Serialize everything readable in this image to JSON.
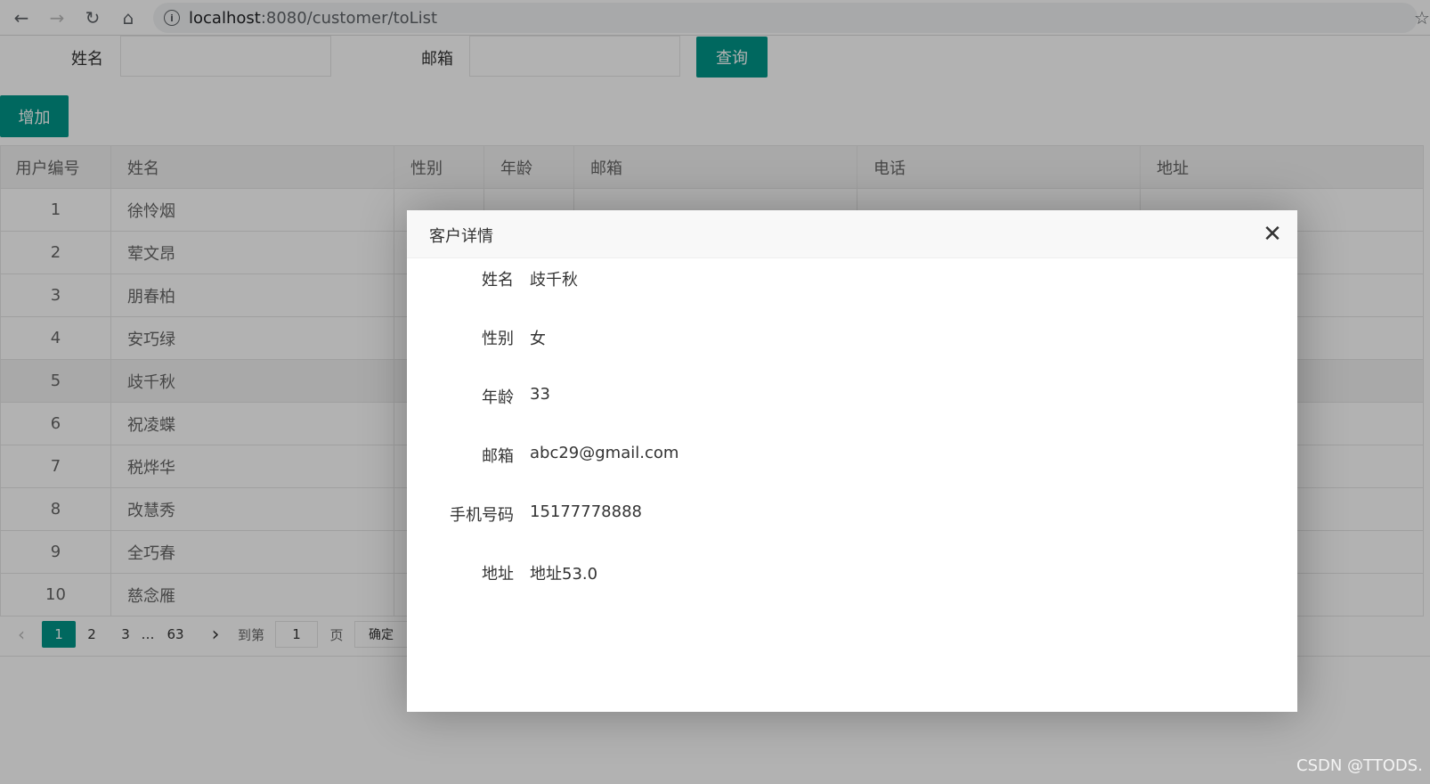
{
  "browser": {
    "url_host": "localhost",
    "url_path": ":8080/customer/toList"
  },
  "search": {
    "name_label": "姓名",
    "email_label": "邮箱",
    "query_button": "查询",
    "name_value": "",
    "email_value": ""
  },
  "add_button": "增加",
  "table": {
    "columns": [
      "用户编号",
      "姓名",
      "性别",
      "年龄",
      "邮箱",
      "电话",
      "地址"
    ],
    "rows": [
      {
        "id": "1",
        "name": "徐怜烟"
      },
      {
        "id": "2",
        "name": "荤文昂"
      },
      {
        "id": "3",
        "name": "朋春柏"
      },
      {
        "id": "4",
        "name": "安巧绿"
      },
      {
        "id": "5",
        "name": "歧千秋"
      },
      {
        "id": "6",
        "name": "祝凌蝶"
      },
      {
        "id": "7",
        "name": "税烨华"
      },
      {
        "id": "8",
        "name": "改慧秀"
      },
      {
        "id": "9",
        "name": "全巧春"
      },
      {
        "id": "10",
        "name": "慈念雁"
      }
    ]
  },
  "pager": {
    "pages": [
      "1",
      "2",
      "3"
    ],
    "ellipsis": "…",
    "last": "63",
    "goto_label": "到第",
    "goto_value": "1",
    "page_unit": "页",
    "confirm": "确定"
  },
  "modal": {
    "title": "客户详情",
    "fields": [
      {
        "label": "姓名",
        "value": "歧千秋"
      },
      {
        "label": "性别",
        "value": "女"
      },
      {
        "label": "年龄",
        "value": "33"
      },
      {
        "label": "邮箱",
        "value": "abc29@gmail.com"
      },
      {
        "label": "手机号码",
        "value": "15177778888"
      },
      {
        "label": "地址",
        "value": "地址53.0"
      }
    ]
  },
  "watermark": "CSDN @TTODS."
}
